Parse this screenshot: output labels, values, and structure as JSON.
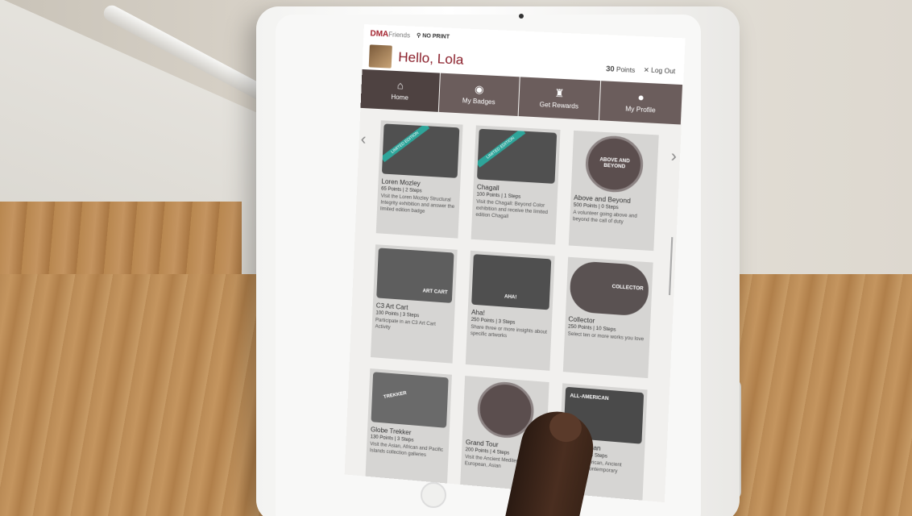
{
  "app": {
    "brand": "DMA",
    "brand_sub": "Friends",
    "location": "NO PRINT",
    "greeting": "Hello, Lola",
    "points_value": "30",
    "points_label": "Points",
    "logout": "Log Out"
  },
  "nav": [
    {
      "label": "Home",
      "icon": "home-icon",
      "glyph": "⌂"
    },
    {
      "label": "My Badges",
      "icon": "badge-icon",
      "glyph": "◉"
    },
    {
      "label": "Get Rewards",
      "icon": "trophy-icon",
      "glyph": "♜"
    },
    {
      "label": "My Profile",
      "icon": "user-icon",
      "glyph": "●"
    }
  ],
  "badges": [
    {
      "title": "Loren Mozley",
      "meta": "65 Points | 2 Steps",
      "desc": "Visit the Loren Mozley Structural Integrity exhibition and answer the limited edition badge",
      "ribbon": "LIMITED EDITION",
      "art": ""
    },
    {
      "title": "Chagall",
      "meta": "100 Points | 1 Steps",
      "desc": "Visit the Chagall: Beyond Color exhibition and receive the limited edition Chagall",
      "ribbon": "LIMITED EDITION",
      "art": ""
    },
    {
      "title": "Above and Beyond",
      "meta": "500 Points | 0 Steps",
      "desc": "A volunteer going above and beyond the call of duty",
      "ribbon": "",
      "art": "ABOVE AND BEYOND"
    },
    {
      "title": "C3 Art Cart",
      "meta": "100 Points | 3 Steps",
      "desc": "Participate in an C3 Art Cart Activity",
      "ribbon": "",
      "art": "ART CART"
    },
    {
      "title": "Aha!",
      "meta": "250 Points | 3 Steps",
      "desc": "Share three or more insights about specific artworks",
      "ribbon": "",
      "art": "AHA!"
    },
    {
      "title": "Collector",
      "meta": "250 Points | 10 Steps",
      "desc": "Select ten or more works you love",
      "ribbon": "",
      "art": "COLLECTOR"
    },
    {
      "title": "Globe Trekker",
      "meta": "130 Points | 3 Steps",
      "desc": "Visit the Asian, African and Pacific Islands collection galleries",
      "ribbon": "",
      "art": "TREKKER"
    },
    {
      "title": "Grand Tour",
      "meta": "200 Points | 4 Steps",
      "desc": "Visit the Ancient Mediterranean, European, Asian",
      "ribbon": "",
      "art": ""
    },
    {
      "title": "All-American",
      "meta": "150 Points | 3 Steps",
      "desc": "Visit the American, Ancient Americas, Contemporary",
      "ribbon": "",
      "art": "ALL-AMERICAN"
    }
  ]
}
